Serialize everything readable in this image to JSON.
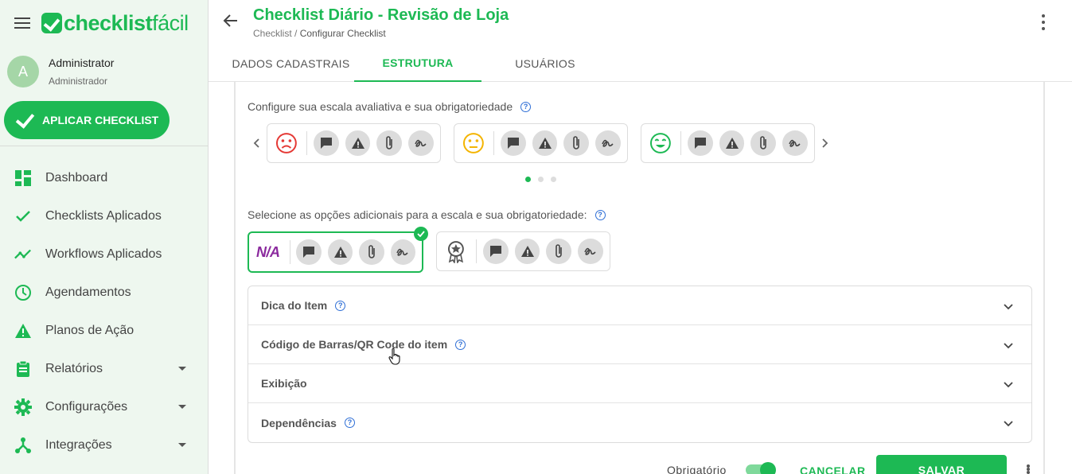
{
  "app": {
    "logo_bold": "checklist",
    "logo_light": "fácil",
    "brand_color": "#1db954"
  },
  "user": {
    "avatar_letter": "A",
    "name": "Administrator",
    "role": "Administrador"
  },
  "sidebar": {
    "apply_button": "APLICAR CHECKLIST",
    "items": [
      {
        "label": "Dashboard",
        "icon": "dashboard-icon"
      },
      {
        "label": "Checklists Aplicados",
        "icon": "check-icon"
      },
      {
        "label": "Workflows Aplicados",
        "icon": "trending-icon"
      },
      {
        "label": "Agendamentos",
        "icon": "clock-icon"
      },
      {
        "label": "Planos de Ação",
        "icon": "warning-icon"
      },
      {
        "label": "Relatórios",
        "icon": "clipboard-icon",
        "expandable": true
      },
      {
        "label": "Configurações",
        "icon": "gear-icon",
        "expandable": true
      },
      {
        "label": "Integrações",
        "icon": "hub-icon",
        "expandable": true
      }
    ]
  },
  "header": {
    "title": "Checklist Diário - Revisão de Loja",
    "breadcrumb_root": "Checklist",
    "breadcrumb_sep": " / ",
    "breadcrumb_current": "Configurar Checklist"
  },
  "tabs": [
    {
      "label": "DADOS CADASTRAIS",
      "active": false
    },
    {
      "label": "ESTRUTURA",
      "active": true
    },
    {
      "label": "USUÁRIOS",
      "active": false
    }
  ],
  "scale": {
    "label": "Configure sua escala avaliativa e sua obrigatoriedade",
    "cards": [
      {
        "face": "sad-face-icon",
        "color": "#e53935"
      },
      {
        "face": "neutral-face-icon",
        "color": "#f4b400"
      },
      {
        "face": "happy-face-icon",
        "color": "#1db954"
      }
    ],
    "page_count": 3,
    "active_page": 0
  },
  "additional": {
    "label": "Selecione as opções adicionais para a escala e sua obrigatoriedade:",
    "na_text": "N/A",
    "na_color": "#8b2a9e"
  },
  "accordion": [
    {
      "label": "Dica do Item",
      "help": true
    },
    {
      "label": "Código de Barras/QR Code do item",
      "help": true
    },
    {
      "label": "Exibição",
      "help": false
    },
    {
      "label": "Dependências",
      "help": true
    }
  ],
  "footer": {
    "required_label": "Obrigatório",
    "required_on": true,
    "cancel_label": "CANCELAR",
    "save_label": "SALVAR"
  }
}
